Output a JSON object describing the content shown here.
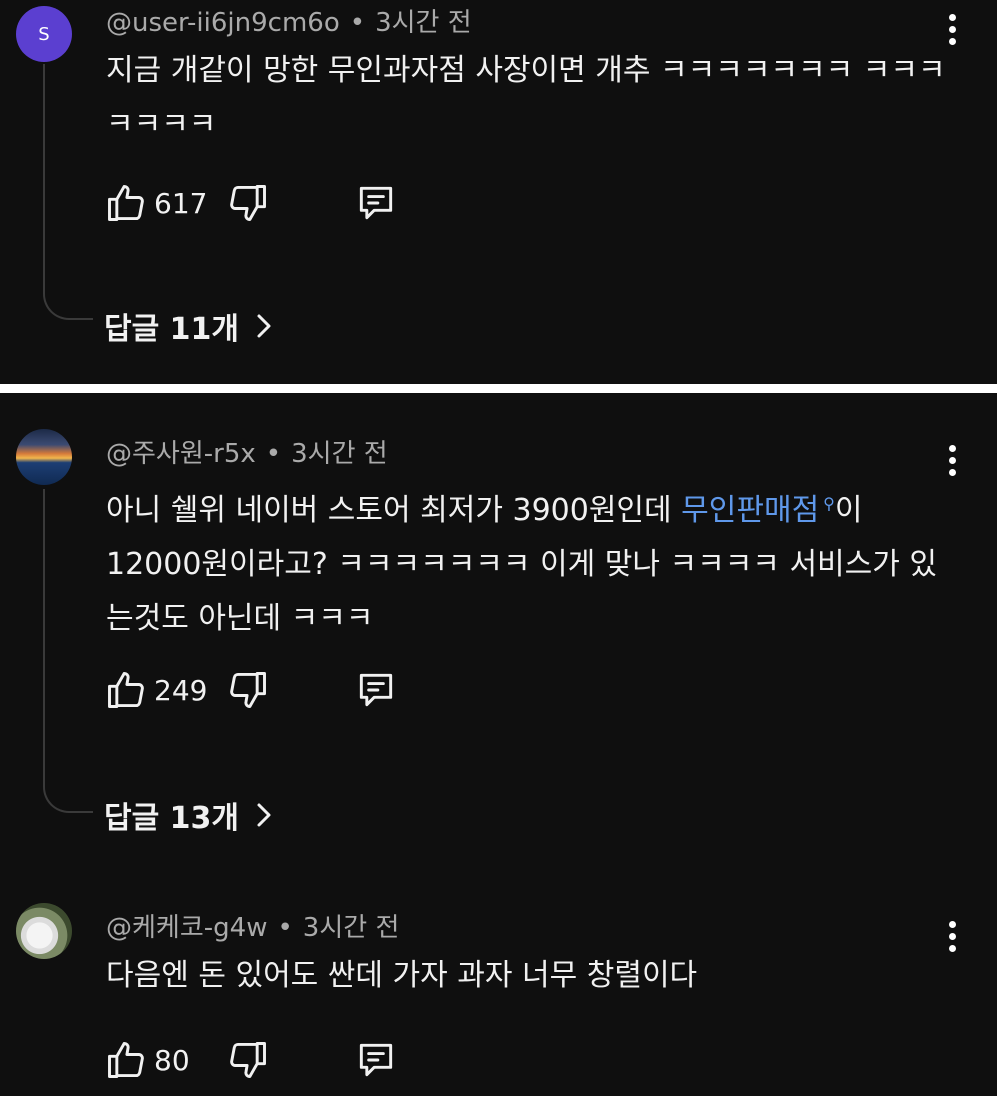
{
  "comments": [
    {
      "avatar_letter": "S",
      "handle": "@user-ii6jn9cm6o",
      "time": "3시간 전",
      "text": "지금 개같이 망한 무인과자점 사장이면 개추 ㅋㅋㅋㅋㅋㅋㅋ ㅋㅋㅋㅋㅋㅋㅋ",
      "likes": "617",
      "replies": "답글 11개"
    },
    {
      "handle": "@주사원-r5x",
      "time": "3시간 전",
      "text_before_link": "아니 쉘위 네이버 스토어 최저가 3900원인데 ",
      "link_text": "무인판매점",
      "text_after_link": "이 12000원이라고? ㅋㅋㅋㅋㅋㅋㅋ 이게 맞나 ㅋㅋㅋㅋ 서비스가 있는것도 아닌데 ㅋㅋㅋ",
      "likes": "249",
      "replies": "답글 13개"
    },
    {
      "handle": "@케케코-g4w",
      "time": "3시간 전",
      "text": "다음엔 돈 있어도 싼데 가자 과자 너무 창렬이다",
      "likes": "80"
    }
  ],
  "icons": {
    "like": "thumbs-up-icon",
    "dislike": "thumbs-down-icon",
    "reply": "comment-icon",
    "more": "more-vertical-icon",
    "chevron": "chevron-right-icon",
    "search": "search-icon"
  },
  "colors": {
    "background": "#0f0f0f",
    "text": "#f1f1f1",
    "meta": "#aaaaaa",
    "link": "#5f98ea"
  }
}
